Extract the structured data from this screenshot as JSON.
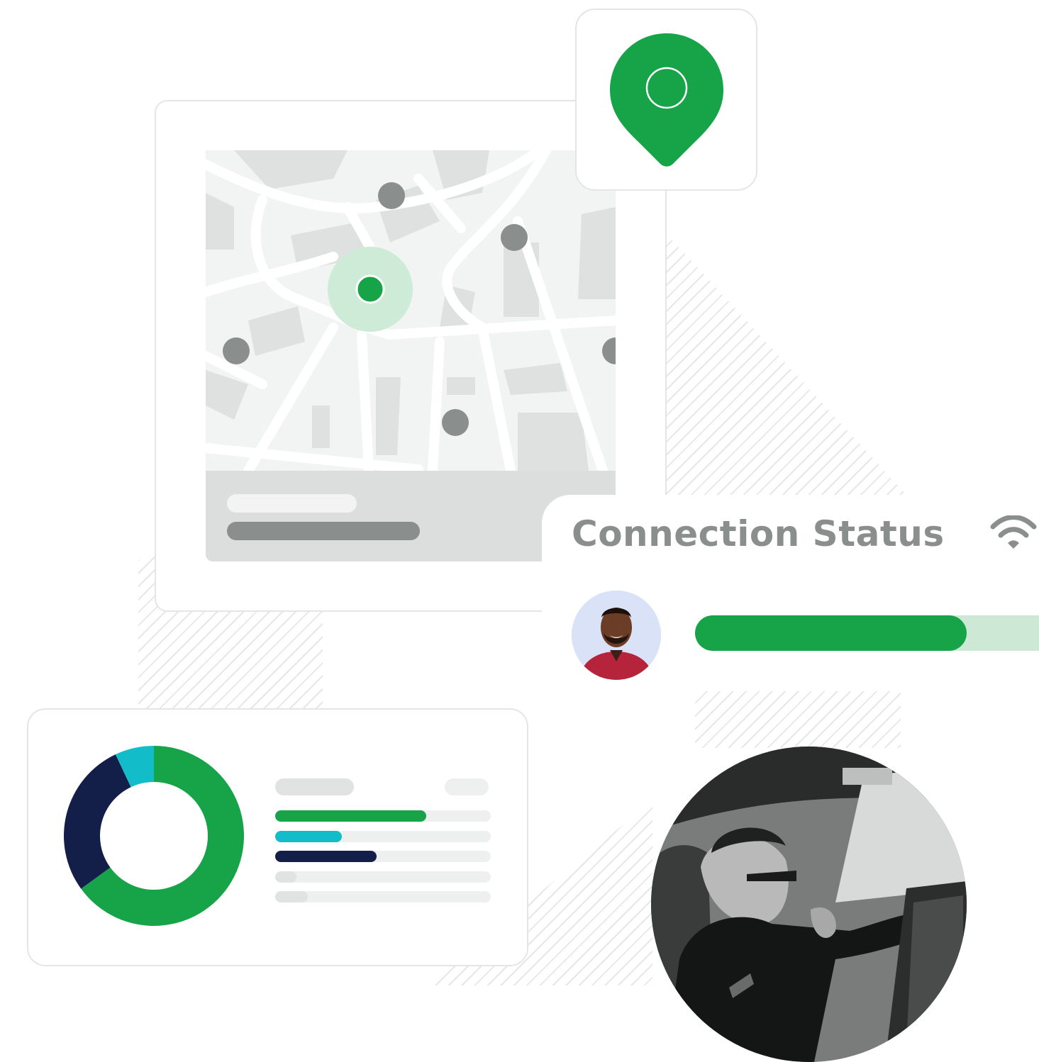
{
  "connection_status": {
    "title": "Connection Status",
    "wifi_icon": "wifi-icon",
    "signal_level_percent": 79,
    "progress_color": "#17a348",
    "track_color": "#cde9d6"
  },
  "map": {
    "pin_icon": "location-pin-icon",
    "selected_marker_color": "#17a348",
    "marker_color": "#8a8e8d"
  },
  "chart_data": {
    "type": "pie",
    "series": [
      {
        "values": [
          65,
          28,
          7
        ],
        "colors": [
          "#17a348",
          "#131f48",
          "#13bcc9"
        ]
      }
    ],
    "bars": [
      {
        "value": 0.7,
        "color": "#17a348"
      },
      {
        "value": 0.31,
        "color": "#13bcc9"
      },
      {
        "value": 0.47,
        "color": "#131f48"
      },
      {
        "value": 0.1,
        "color": "#e1e3e2"
      },
      {
        "value": 0.15,
        "color": "#e1e3e2"
      }
    ]
  },
  "colors": {
    "brand_green": "#17a348",
    "navy": "#131f48",
    "teal": "#13bcc9",
    "card_border": "#e4e6e5"
  }
}
